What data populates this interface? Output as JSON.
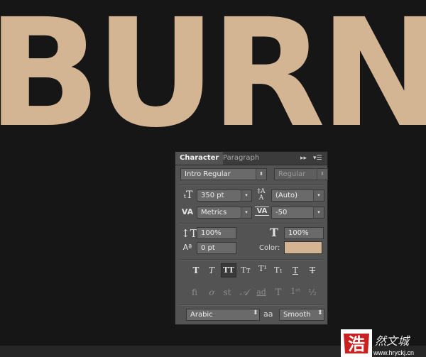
{
  "canvas": {
    "text": "BURN",
    "text_color": "#d3b593",
    "background": "#161616"
  },
  "panel": {
    "tabs": [
      "Character",
      "Paragraph"
    ],
    "font_family": "Intro  Regular",
    "font_style": "Regular",
    "font_size": "350 pt",
    "leading": "(Auto)",
    "kerning": "Metrics",
    "tracking": "-50",
    "vertical_scale": "100%",
    "horizontal_scale": "100%",
    "baseline_shift": "0 pt",
    "color_label": "Color:",
    "color": "#d3b593",
    "language": "Arabic",
    "antialias": "Smooth",
    "aa_icon": "aa"
  },
  "watermark": {
    "text": "www.hryckj.cn"
  }
}
